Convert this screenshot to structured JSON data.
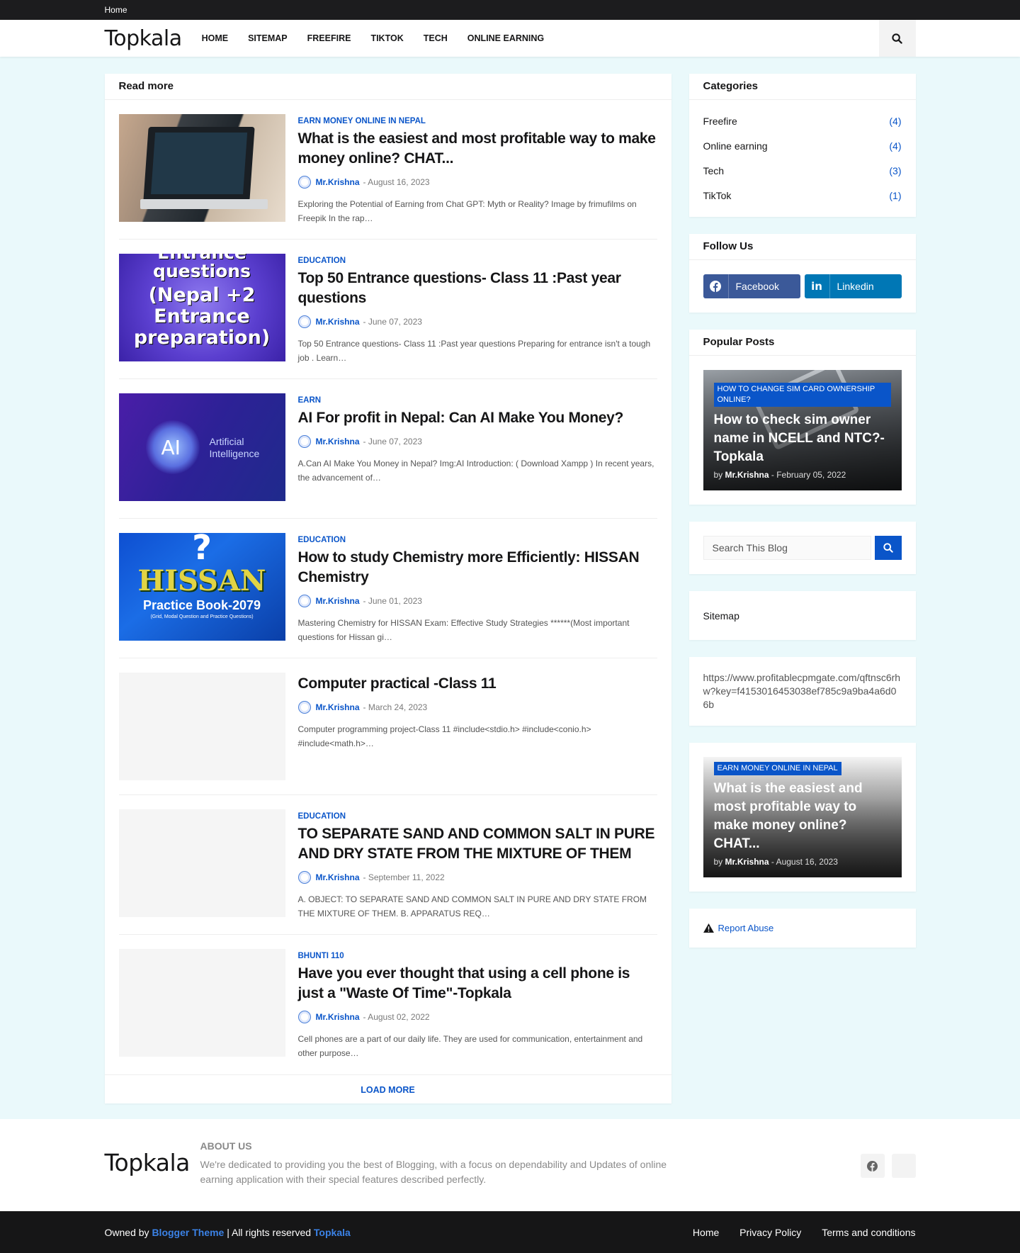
{
  "topbar": {
    "home_link": "Home"
  },
  "header": {
    "logo": "Topkala",
    "nav": [
      "HOME",
      "SITEMAP",
      "FREEFIRE",
      "TIKTOK",
      "TECH",
      "ONLINE EARNING"
    ]
  },
  "main": {
    "title": "Read more",
    "posts": [
      {
        "category": "EARN MONEY ONLINE IN NEPAL",
        "title": "What is the easiest and most profitable way to make money online? CHAT...",
        "author": "Mr.Krishna",
        "date": "- August 16, 2023",
        "snippet": "Exploring the Potential of Earning from Chat GPT: Myth or Reality? Image by frimufilms on Freepik In the rap…"
      },
      {
        "category": "EDUCATION",
        "title": "Top 50 Entrance questions- Class 11 :Past year questions",
        "author": "Mr.Krishna",
        "date": "- June 07, 2023",
        "snippet": "Top 50 Entrance questions- Class 11 :Past year questions Preparing for entrance isn't a tough job . Learn…",
        "thumb_text": [
          "Entrance",
          "questions",
          "(Nepal +2",
          "Entrance",
          "preparation)"
        ]
      },
      {
        "category": "EARN",
        "title": "AI For profit in Nepal: Can AI Make You Money?",
        "author": "Mr.Krishna",
        "date": "- June 07, 2023",
        "snippet": "A.Can AI Make You Money in Nepal? Img:AI Introduction: ( Download Xampp ) In recent years, the advancement of…",
        "thumb_text": [
          "AI",
          "Artificial",
          "Intelligence"
        ]
      },
      {
        "category": "EDUCATION",
        "title": "How to study Chemistry more Efficiently: HISSAN Chemistry",
        "author": "Mr.Krishna",
        "date": "- June 01, 2023",
        "snippet": "Mastering Chemistry for HISSAN Exam: Effective Study Strategies ******(Most important questions for Hissan gi…",
        "thumb_text": [
          "?",
          "HISSAN",
          "Practice Book-2079",
          "(Grid, Modal Question and Practice Questions)"
        ]
      },
      {
        "category": "",
        "title": "Computer practical -Class 11",
        "author": "Mr.Krishna",
        "date": "- March 24, 2023",
        "snippet": "Computer programming project-Class 11  #include<stdio.h> #include<conio.h> #include<math.h>…"
      },
      {
        "category": "EDUCATION",
        "title": "TO SEPARATE SAND AND COMMON SALT IN PURE AND DRY STATE FROM THE MIXTURE OF THEM",
        "author": "Mr.Krishna",
        "date": "- September 11, 2022",
        "snippet": "A. OBJECT:  TO SEPARATE SAND AND COMMON SALT IN PURE AND DRY STATE FROM THE MIXTURE OF THEM. B. APPARATUS REQ…"
      },
      {
        "category": "BHUNTI 110",
        "title": "Have you ever thought that using a cell phone is just a \"Waste Of Time\"-Topkala",
        "author": "Mr.Krishna",
        "date": "- August 02, 2022",
        "snippet": "Cell phones are a part of our daily life.  They are used for communication, entertainment and other purpose…"
      }
    ],
    "load_more": "LOAD MORE"
  },
  "sidebar": {
    "categories": {
      "title": "Categories",
      "items": [
        {
          "label": "Freefire",
          "count": "(4)"
        },
        {
          "label": "Online earning",
          "count": "(4)"
        },
        {
          "label": "Tech",
          "count": "(3)"
        },
        {
          "label": "TikTok",
          "count": "(1)"
        }
      ]
    },
    "follow": {
      "title": "Follow Us",
      "facebook": "Facebook",
      "linkedin": "Linkedin"
    },
    "popular": {
      "title": "Popular Posts",
      "tag": "HOW TO CHANGE SIM CARD OWNERSHIP ONLINE?",
      "post_title": "How to check sim owner name in NCELL and NTC?-Topkala",
      "by": "by",
      "author": "Mr.Krishna",
      "date": "- February 05, 2022"
    },
    "search": {
      "placeholder": "Search This Blog"
    },
    "sitemap": "Sitemap",
    "url_text": "https://www.profitablecpmgate.com/qftnsc6rhw?key=f4153016453038ef785c9a9ba4a6d06b",
    "featured": {
      "tag": "EARN MONEY ONLINE IN NEPAL",
      "post_title": "What is the easiest and most profitable way to make money online? CHAT...",
      "by": "by",
      "author": "Mr.Krishna",
      "date": "- August 16, 2023"
    },
    "report_abuse": "Report Abuse"
  },
  "footer": {
    "logo": "Topkala",
    "about_title": "ABOUT US",
    "about_text": "We're dedicated to providing you the best of Blogging, with a focus on dependability and Updates of online earning application with their special features described perfectly.",
    "owned_by": "Owned by",
    "blogger_theme": "Blogger Theme",
    "rights": "| All rights reserved",
    "site_name": "Topkala",
    "links": [
      "Home",
      "Privacy Policy",
      "Terms and conditions"
    ]
  },
  "colors": {
    "accent": "#0a55c9",
    "page_bg": "#eaf9fb",
    "topbar_bg": "#1c1c1e",
    "facebook": "#3b5999",
    "linkedin": "#0077b5"
  }
}
